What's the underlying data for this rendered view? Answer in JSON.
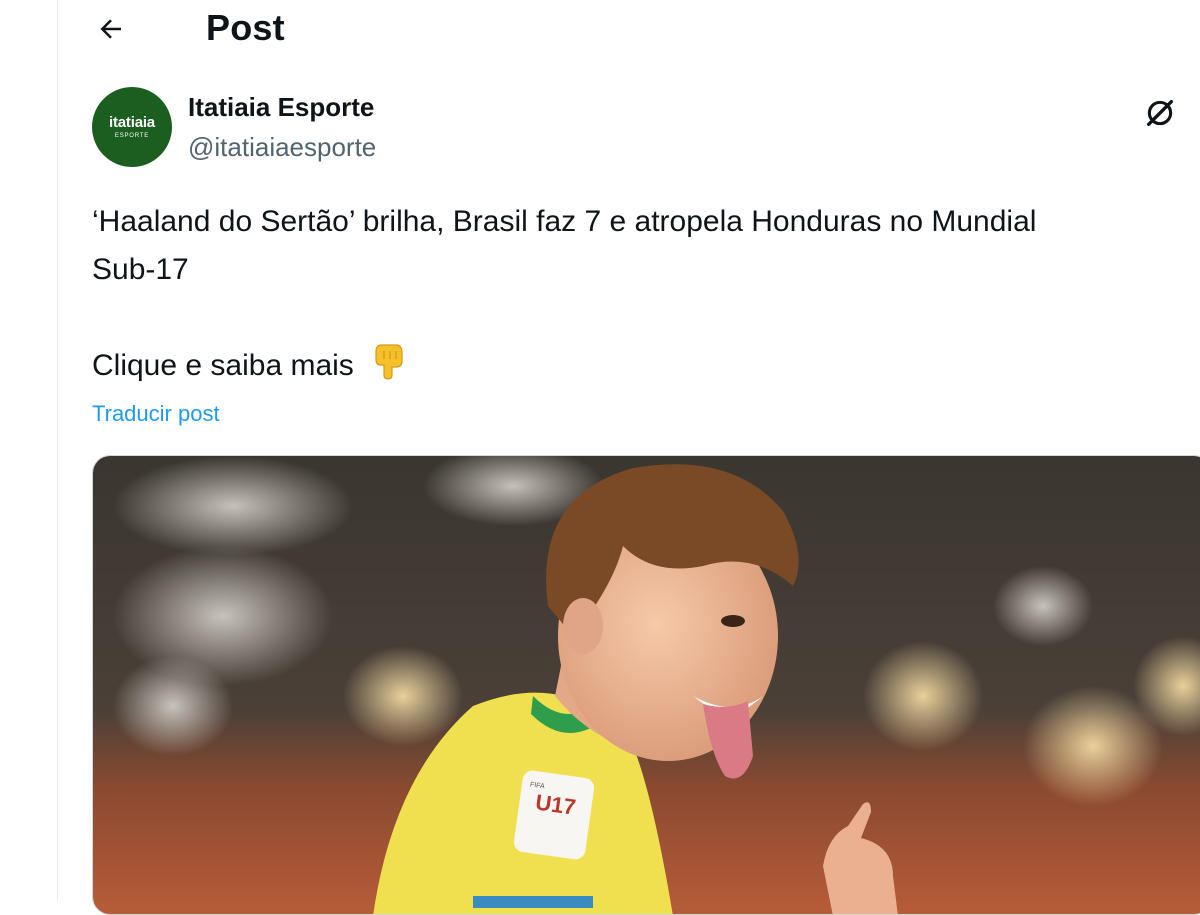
{
  "header": {
    "title": "Post"
  },
  "author": {
    "display_name": "Itatiaia Esporte",
    "handle": "@itatiaiaesporte",
    "avatar_brand": "itatiaia",
    "avatar_sub": "ESPORTE"
  },
  "post": {
    "line1": "‘Haaland do Sertão’ brilha, Brasil faz 7 e atropela Honduras no Mundial",
    "line2": "Sub-17",
    "cta": "Clique e saiba mais",
    "cta_icon": "backhand-index-pointing-down-icon",
    "translate_label": "Traducir post"
  },
  "media": {
    "patch_text": "U17",
    "patch_small": "FIFA"
  },
  "colors": {
    "link": "#1d9bf0",
    "secondary_text": "#536471",
    "avatar_bg": "#1b5e20",
    "jersey": "#f5e04a"
  }
}
